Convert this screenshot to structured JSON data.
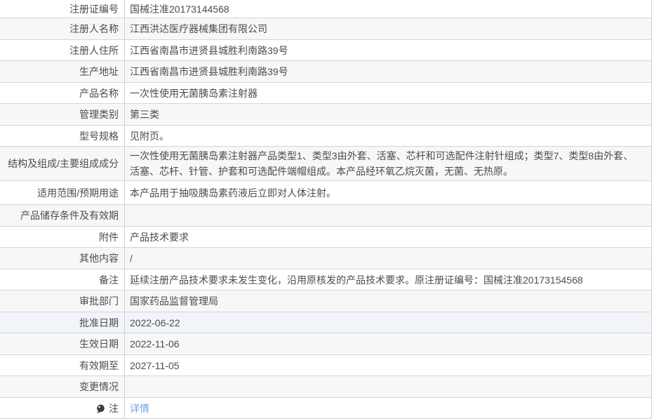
{
  "page": {
    "type": "medical-device-registration-detail"
  },
  "colors": {
    "row_alt_bg": "#f7f7f7",
    "row_highlight_bg": "#f1f4f9",
    "border": "#d5d5d5",
    "text": "#4c4c4c",
    "link": "#6fa3df"
  },
  "table": {
    "rows": [
      {
        "label": "注册证编号",
        "value": "国械注准20173144568"
      },
      {
        "label": "注册人名称",
        "value": "江西洪达医疗器械集团有限公司"
      },
      {
        "label": "注册人住所",
        "value": "江西省南昌市进贤县城胜利南路39号"
      },
      {
        "label": "生产地址",
        "value": "江西省南昌市进贤县城胜利南路39号"
      },
      {
        "label": "产品名称",
        "value": "一次性使用无菌胰岛素注射器"
      },
      {
        "label": "管理类别",
        "value": "第三类"
      },
      {
        "label": "型号规格",
        "value": "见附页。"
      },
      {
        "label": "结构及组成/主要组成成分",
        "value": "一次性使用无菌胰岛素注射器产品类型1、类型3由外套、活塞、芯杆和可选配件注射针组成；类型7、类型8由外套、活塞、芯杆、针管、护套和可选配件端帽组成。本产品经环氧乙烷灭菌，无菌、无热原。"
      },
      {
        "label": "适用范围/预期用途",
        "value": "本产品用于抽吸胰岛素药液后立即对人体注射。"
      },
      {
        "label": "产品储存条件及有效期",
        "value": ""
      },
      {
        "label": "附件",
        "value": "产品技术要求"
      },
      {
        "label": "其他内容",
        "value": "/"
      },
      {
        "label": "备注",
        "value": "延续注册产品技术要求未发生变化，沿用原核发的产品技术要求。原注册证编号：国械注准20173154568"
      },
      {
        "label": "审批部门",
        "value": "国家药品监督管理局"
      },
      {
        "label": "批准日期",
        "value": "2022-06-22"
      },
      {
        "label": "生效日期",
        "value": "2022-11-06"
      },
      {
        "label": "有效期至",
        "value": "2027-11-05"
      },
      {
        "label": "变更情况",
        "value": ""
      },
      {
        "label": "注",
        "value": "详情",
        "link": true,
        "icon": "note-balloon-icon"
      }
    ]
  }
}
